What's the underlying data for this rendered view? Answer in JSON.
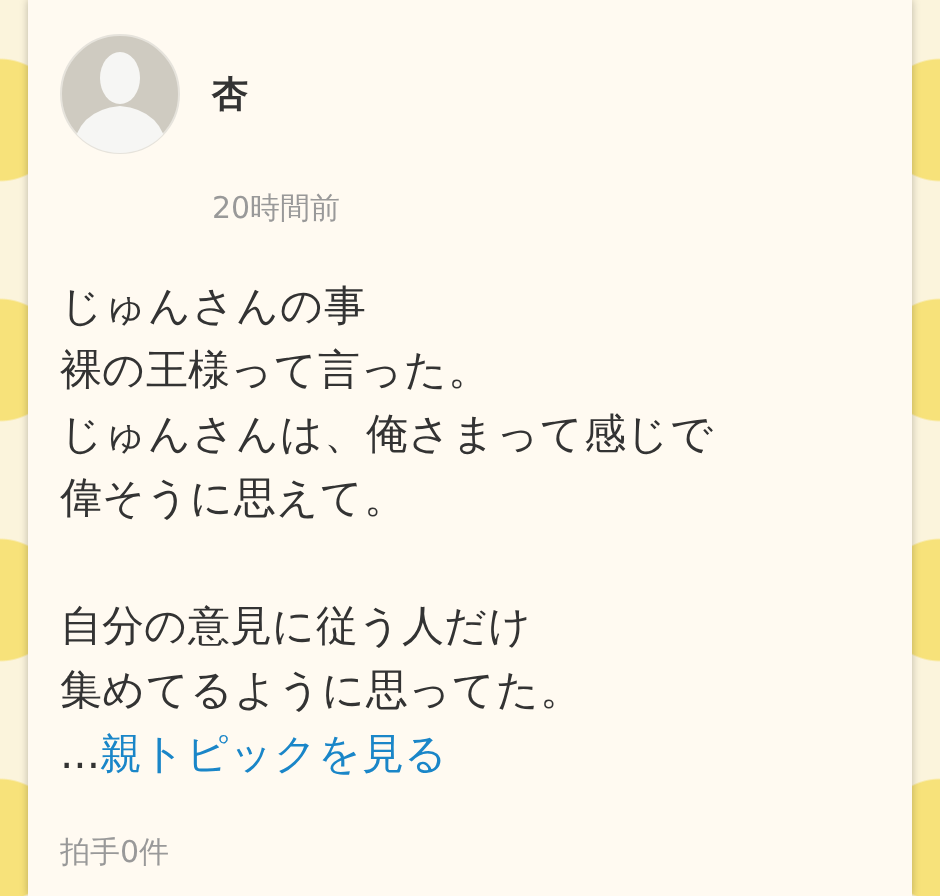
{
  "post": {
    "author": "杏",
    "time": "20時間前",
    "paragraphs": [
      [
        "じゅんさんの事",
        "裸の王様って言った。",
        "じゅんさんは、俺さまって感じで",
        "偉そうに思えて。"
      ],
      [
        "自分の意見に従う人だけ",
        "集めてるように思ってた。"
      ]
    ],
    "more": {
      "ellipsis": "...",
      "link": "親トピックを見る"
    },
    "claps": "拍手0件"
  }
}
